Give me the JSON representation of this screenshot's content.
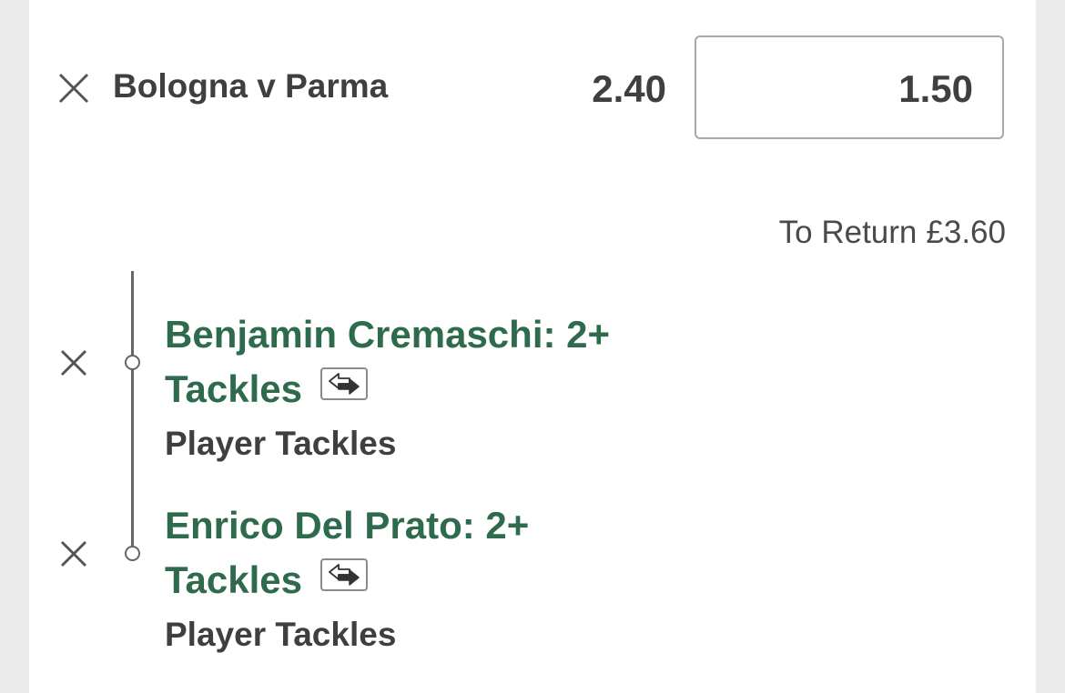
{
  "bet": {
    "match": "Bologna v Parma",
    "odds": "2.40",
    "stake": "1.50",
    "to_return_label": "To Return",
    "to_return_value": "£3.60"
  },
  "selections": [
    {
      "name_line1": "Benjamin Cremaschi: 2+",
      "name_line2": "Tackles",
      "market": "Player Tackles"
    },
    {
      "name_line1": "Enrico Del Prato: 2+",
      "name_line2": "Tackles",
      "market": "Player Tackles"
    }
  ],
  "colors": {
    "selection_green": "#2e6a4c",
    "text_dark": "#3f3f3f",
    "background": "#ebebeb"
  }
}
